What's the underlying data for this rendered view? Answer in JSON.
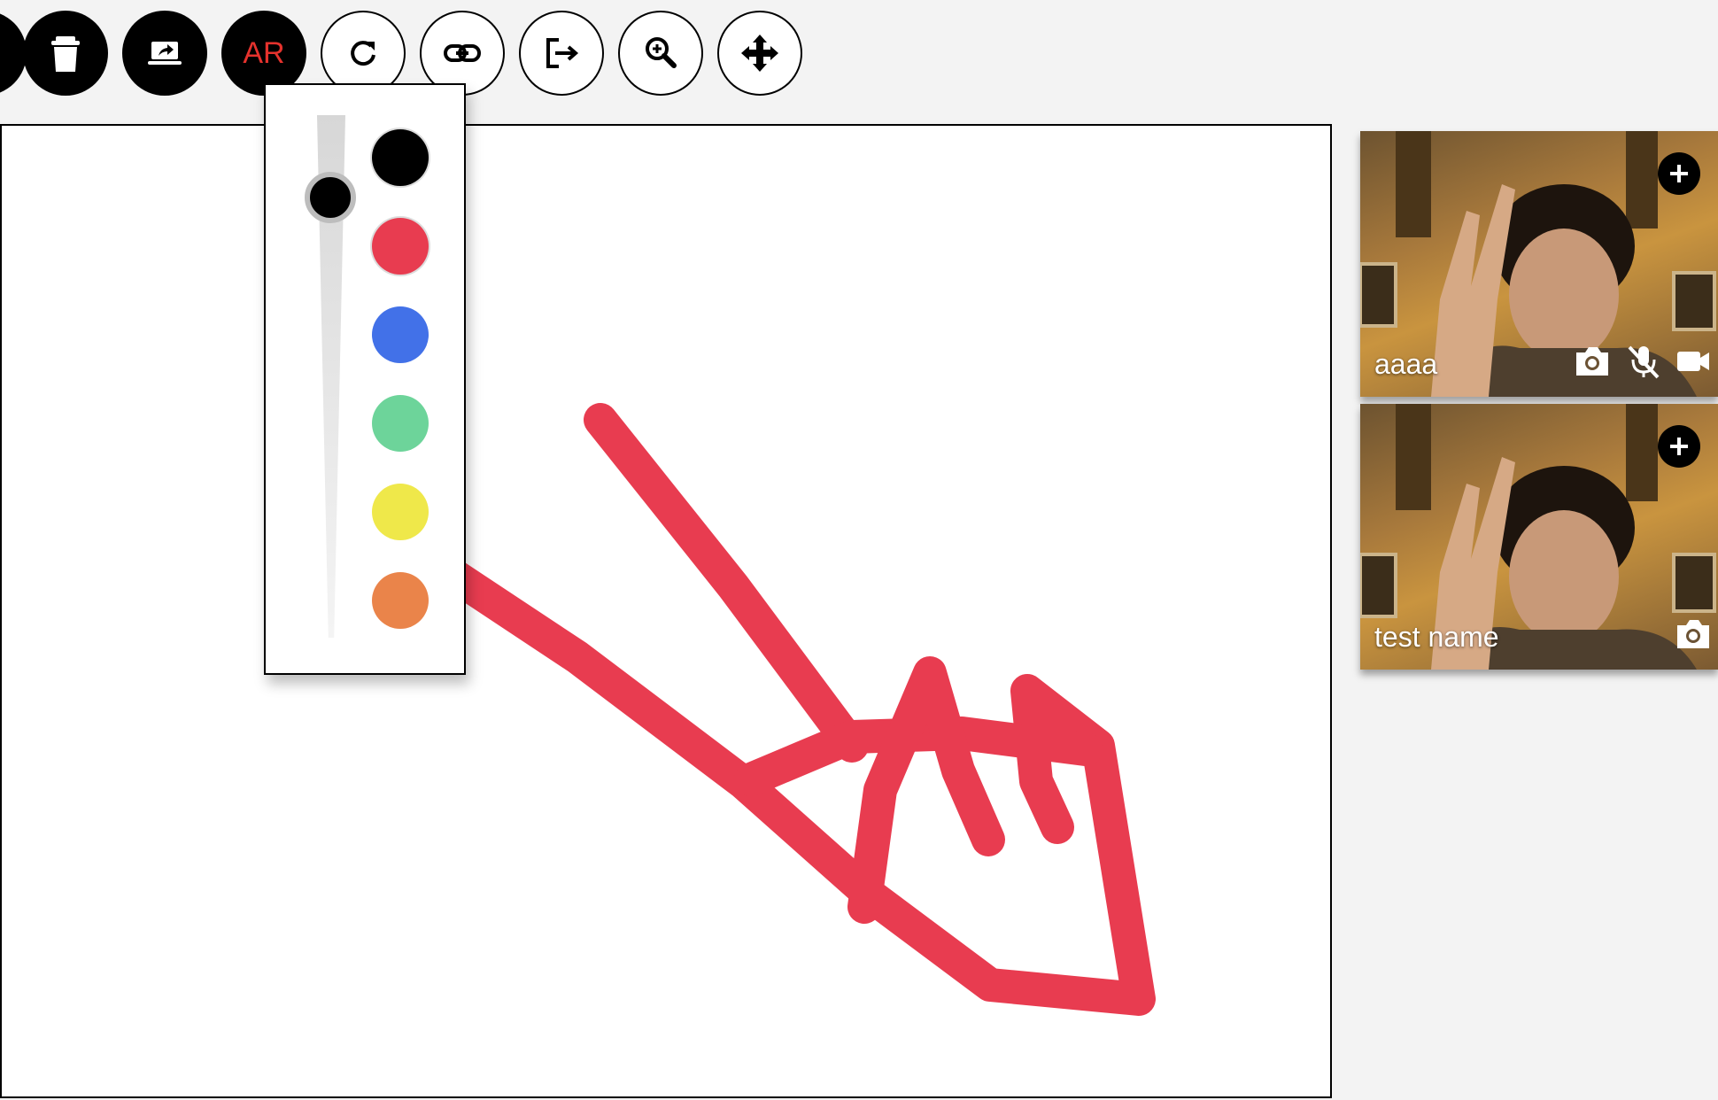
{
  "toolbar": {
    "ar_label": "AR",
    "buttons": [
      "partial-button",
      "trash",
      "share-screen",
      "ar",
      "refresh",
      "link",
      "exit",
      "zoom-in",
      "move"
    ]
  },
  "palette": {
    "colors": [
      "#000000",
      "#e83c50",
      "#4271e8",
      "#6dd49a",
      "#efe84a",
      "#ea844a"
    ],
    "selected_color": "#000000",
    "brush_size_level": 0.13
  },
  "drawing": {
    "stroke_color": "#e83c50"
  },
  "participants": [
    {
      "name": "aaaa",
      "icons": [
        "plus-icon",
        "camera-icon",
        "mic-off-icon",
        "video-icon"
      ]
    },
    {
      "name": "test name",
      "icons": [
        "plus-icon",
        "camera-icon"
      ]
    }
  ]
}
